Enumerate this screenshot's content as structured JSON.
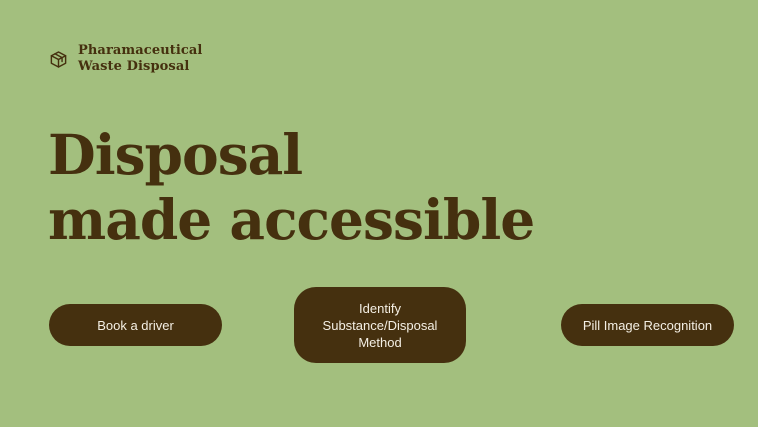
{
  "brand": {
    "line1": "Pharamaceutical",
    "line2": "Waste Disposal",
    "icon": "cube-icon"
  },
  "hero": {
    "line1": "Disposal",
    "line2": "made accessible"
  },
  "actions": {
    "book_driver": "Book a driver",
    "identify": "Identify Substance/Disposal Method",
    "pill_recognition": "Pill Image Recognition"
  },
  "colors": {
    "background": "#a3bf7e",
    "primary_dark": "#45300f",
    "button_text": "#f4efe4"
  }
}
